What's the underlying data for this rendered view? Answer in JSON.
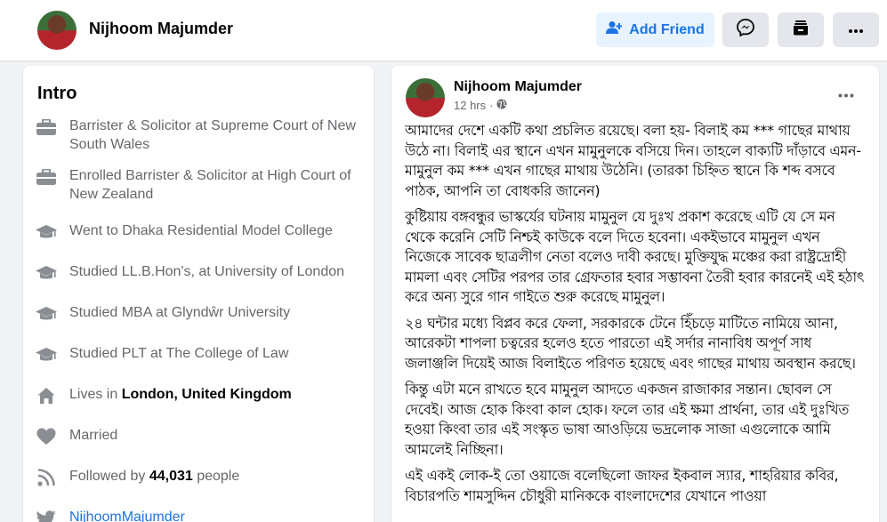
{
  "profile": {
    "name": "Nijhoom Majumder"
  },
  "header": {
    "add_friend_label": "Add Friend"
  },
  "intro": {
    "title": "Intro",
    "items": [
      {
        "icon": "briefcase-icon",
        "text": "Barrister & Solicitor at Supreme Court of New South Wales"
      },
      {
        "icon": "briefcase-icon",
        "text": "Enrolled Barrister & Solicitor at High Court of New Zealand"
      },
      {
        "icon": "graduation-cap-icon",
        "text": "Went to Dhaka Residential Model College"
      },
      {
        "icon": "graduation-cap-icon",
        "text": "Studied LL.B.Hon's, at University of London"
      },
      {
        "icon": "graduation-cap-icon",
        "text": "Studied MBA at Glyndŵr University"
      },
      {
        "icon": "graduation-cap-icon",
        "text": "Studied PLT at The College of Law"
      },
      {
        "icon": "home-icon",
        "prefix": "Lives in ",
        "bold": "London, United Kingdom"
      },
      {
        "icon": "heart-icon",
        "text": "Married"
      },
      {
        "icon": "rss-icon",
        "prefix": "Followed by ",
        "bold": "44,031",
        "suffix": " people"
      },
      {
        "icon": "twitter-icon",
        "link": "NijhoomMajumder"
      }
    ]
  },
  "post": {
    "author": "Nijhoom Majumder",
    "time": "12 hrs",
    "separator": "·",
    "paragraphs": [
      "আমাদের দেশে একটি কথা প্রচলিত রয়েছে। বলা হয়- বিলাই কম *** গাছের মাথায় উঠে না। বিলাই এর স্থানে এখন মামুনুলকে বসিয়ে দিন। তাহলে বাক্যটি দাঁড়াবে এমন- মামুনুল কম *** এখন গাছের মাথায় উঠেনি। (তারকা চিহ্নিত স্থানে কি শব্দ বসবে পাঠক, আপনি তা বোধকরি জানেন)",
      "কুষ্টিয়ায় বঙ্গবন্ধুর ভাস্কর্যের ঘটনায় মামুনুল যে দুঃখ প্রকাশ করেছে এটি যে সে মন থেকে করেনি সেটি নিশ্চই কাউকে বলে দিতে হবেনা। একইভাবে মামুনুল এখন নিজেকে সাবেক ছাত্রলীগ নেতা বলেও দাবী করছে। মুক্তিযুদ্ধ মঞ্চের করা রাষ্ট্রদ্রোহী মামলা এবং সেটির পরপর তার গ্রেফতার হবার সম্ভাবনা তৈরী হবার কারনেই এই হঠাৎ করে অন্য সুরে গান গাইতে শুরু করেছে মামুনুল।",
      "২৪ ঘন্টার মধ্যে বিপ্লব করে ফেলা, সরকারকে টেনে হিঁচড়ে মাটিতে নামিয়ে আনা, আরেকটা শাপলা চত্বরের হলেও হতে পারতো এই সর্দার নানাবিধ অপূর্ণ সাধ জলাঞ্জলি দিয়েই আজ বিলাইতে পরিণত হয়েছে এবং গাছের মাথায় অবস্থান করছে।",
      "কিন্তু এটা মনে রাখতে হবে মামুনুল আদতে একজন রাজাকার সন্তান। ছোবল সে দেবেই। আজ হোক কিংবা কাল হোক। ফলে তার এই ক্ষমা প্রার্থনা, তার এই দুঃখিত হওয়া কিংবা তার এই সংস্কৃত ভাষা আওড়িয়ে ভদ্রলোক সাজা এগুলোকে আমি আমলেই নিচ্ছিনা।",
      "এই একই লোক-ই তো ওয়াজে বলেছিলো জাফর ইকবাল স্যার, শাহরিয়ার কবির, বিচারপতি শামসুদ্দিন চৌধুরী মানিককে বাংলাদেশের যেখানে পাওয়া"
    ]
  },
  "colors": {
    "accent": "#1b74e4",
    "accent_bg": "#e7f3ff",
    "page_bg": "#f0f2f5",
    "icon_gray": "#8a8d91"
  }
}
